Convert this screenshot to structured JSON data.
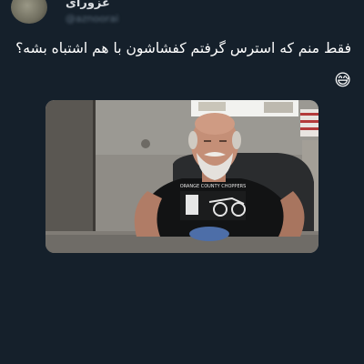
{
  "tweet": {
    "author": {
      "display_name": "عزورای",
      "handle": "@aznoorai",
      "avatar_icon": "user-avatar"
    },
    "text": "فقط منم که استرس گرفتم کفشاشون با هم اشتباه بشه؟",
    "emoji": "😅",
    "media": {
      "shirt_text": "ORANGE COUNTY CHOPPERS",
      "description_icon": "photo-man-black-tshirt"
    }
  },
  "colors": {
    "background": "#15202b",
    "text": "#ffffff",
    "secondary": "#8899a6"
  }
}
